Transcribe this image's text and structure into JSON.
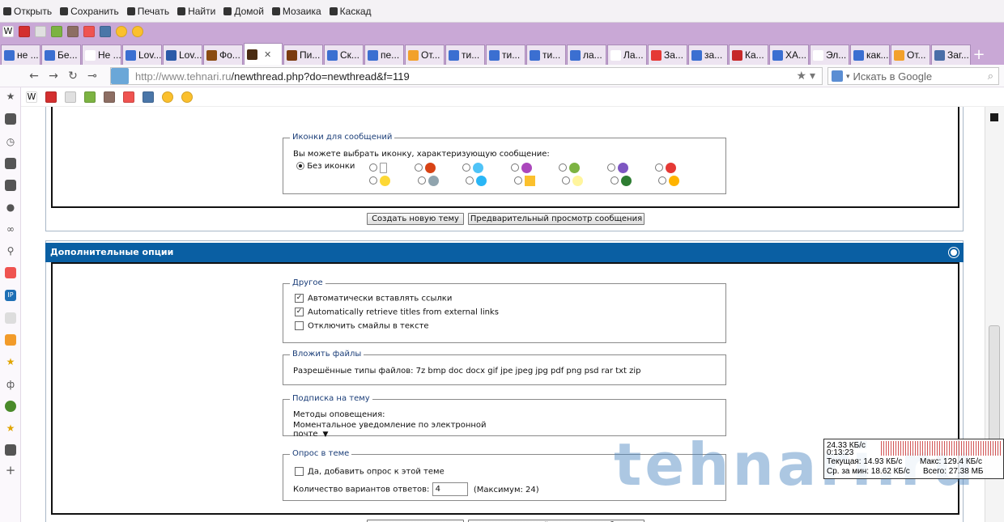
{
  "menu": {
    "open": "Открыть",
    "save": "Сохранить",
    "print": "Печать",
    "find": "Найти",
    "home": "Домой",
    "mosaic": "Мозаика",
    "cascade": "Каскад"
  },
  "tabs": [
    {
      "label": "не ...",
      "color": "#3b6fd1"
    },
    {
      "label": "Бе...",
      "color": "#3b6fd1"
    },
    {
      "label": "Не ...",
      "color": "#ffffff"
    },
    {
      "label": "Lov...",
      "color": "#3b6fd1"
    },
    {
      "label": "Lov...",
      "color": "#2a5aa8"
    },
    {
      "label": "Фо...",
      "color": "#8a4b12"
    },
    {
      "label": "",
      "color": "#4a2c12",
      "active": true
    },
    {
      "label": "Пи...",
      "color": "#7a3b10"
    },
    {
      "label": "Ск...",
      "color": "#3b6fd1"
    },
    {
      "label": "пе...",
      "color": "#3b6fd1"
    },
    {
      "label": "От...",
      "color": "#f2a12b"
    },
    {
      "label": "ти...",
      "color": "#3b6fd1"
    },
    {
      "label": "ти...",
      "color": "#3b6fd1"
    },
    {
      "label": "ти...",
      "color": "#3b6fd1"
    },
    {
      "label": "ла...",
      "color": "#3b6fd1"
    },
    {
      "label": "Ла...",
      "color": "#ffffff"
    },
    {
      "label": "За...",
      "color": "#e53935"
    },
    {
      "label": "за...",
      "color": "#3b6fd1"
    },
    {
      "label": "Ка...",
      "color": "#c62828"
    },
    {
      "label": "ХА...",
      "color": "#3b6fd1"
    },
    {
      "label": "Эл...",
      "color": "#ffffff"
    },
    {
      "label": "как...",
      "color": "#3b6fd1"
    },
    {
      "label": "От...",
      "color": "#f2a12b"
    },
    {
      "label": "Заг...",
      "color": "#4a6fa8"
    }
  ],
  "address": {
    "url_host": "http://www.tehnari.ru",
    "url_path": "/newthread.php?do=newthread&f=119",
    "search_placeholder": "Искать в Google"
  },
  "icons_section": {
    "legend": "Иконки для сообщений",
    "desc": "Вы можете выбрать иконку, характеризующую сообщение:",
    "no_icon": "Без иконки"
  },
  "buttons": {
    "create": "Создать новую тему",
    "preview": "Предварительный просмотр сообщения"
  },
  "options": {
    "header": "Дополнительные опции"
  },
  "other": {
    "legend": "Другое",
    "opt1": "Автоматически вставлять ссылки",
    "opt2": "Automatically retrieve titles from external links",
    "opt3": "Отключить смайлы в тексте"
  },
  "attach": {
    "legend": "Вложить файлы",
    "types": "Разрешённые типы файлов: 7z bmp doc docx gif jpe jpeg jpg pdf png psd rar txt zip"
  },
  "subscribe": {
    "legend": "Подписка на тему",
    "label": "Методы оповещения:",
    "value": "Моментальное уведомление по электронной почте"
  },
  "poll": {
    "legend": "Опрос в теме",
    "add": "Да, добавить опрос к этой теме",
    "count_label": "Количество вариантов ответов:",
    "count_value": "4",
    "max": "(Максимум: 24)"
  },
  "net": {
    "line1": "24.33 КБ/с",
    "line2": "0:13:23",
    "current": "Текущая: 14.93 КБ/с",
    "max": "Макс: 129.4 КБ/с",
    "avg": "Ср. за мин: 18.62 КБ/с",
    "total": "Всего: 27.38 МБ"
  },
  "watermark": "tehnari.ru"
}
